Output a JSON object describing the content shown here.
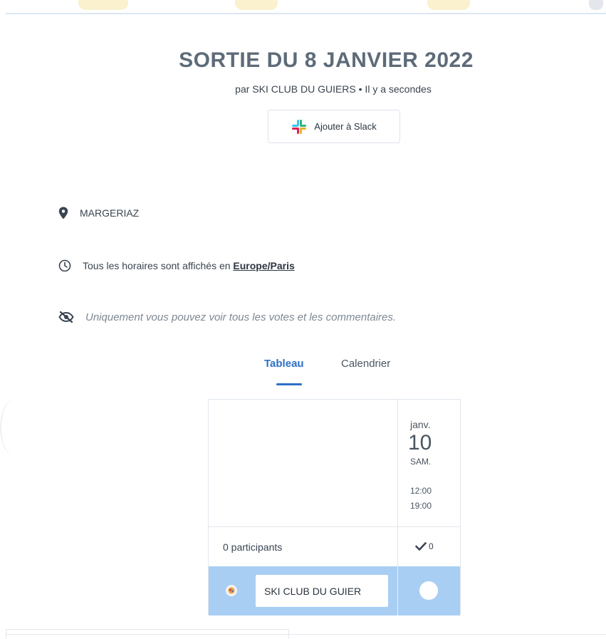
{
  "event": {
    "title": "SORTIE DU 8 JANVIER 2022",
    "subtitle": "par SKI CLUB DU GUIERS • Il y a secondes",
    "slack_button_label": "Ajouter à Slack"
  },
  "info": {
    "location": "MARGERIAZ",
    "timezone_prefix": "Tous les horaires sont affichés en",
    "timezone_link": "Europe/Paris",
    "privacy_note": "Uniquement vous pouvez voir tous les votes et les commentaires."
  },
  "tabs": [
    {
      "label": "Tableau",
      "active": true
    },
    {
      "label": "Calendrier",
      "active": false
    }
  ],
  "poll": {
    "date": {
      "month": "janv.",
      "day": "10",
      "weekday": "SAM.",
      "time_start": "12:00",
      "time_end": "19:00"
    },
    "participants_label": "0 participants",
    "yes_count": "0",
    "entry_name": "SKI CLUB DU GUIER"
  },
  "colors": {
    "accent": "#2d6fc6",
    "entry_row": "#a9cef3",
    "title": "#5e6b79"
  },
  "icons": {
    "slack": "slack-icon",
    "location": "map-pin-icon",
    "timezone": "clock-icon",
    "privacy": "eye-slash-icon",
    "check": "check-icon"
  }
}
